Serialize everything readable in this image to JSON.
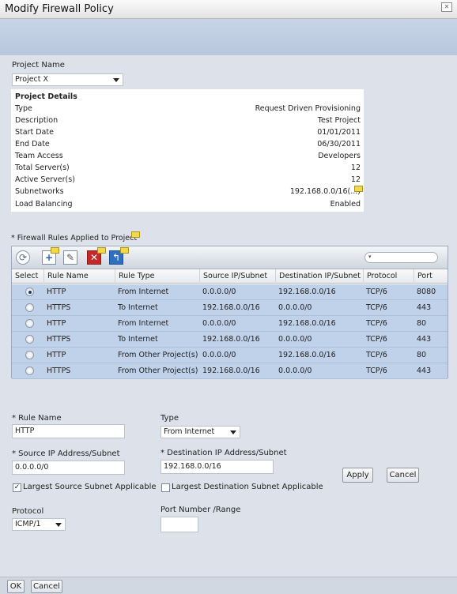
{
  "window": {
    "title": "Modify Firewall Policy"
  },
  "project": {
    "label": "Project Name",
    "selected": "Project X",
    "details_header": "Project Details",
    "details": [
      {
        "key": "Type",
        "value": "Request Driven Provisioning"
      },
      {
        "key": "Description",
        "value": "Test Project"
      },
      {
        "key": "Start Date",
        "value": "01/01/2011"
      },
      {
        "key": "End Date",
        "value": "06/30/2011"
      },
      {
        "key": "Team Access",
        "value": "Developers"
      },
      {
        "key": "Total Server(s)",
        "value": "12"
      },
      {
        "key": "Active Server(s)",
        "value": "12"
      },
      {
        "key": "Subnetworks",
        "value": "192.168.0.0/16(...)"
      },
      {
        "key": "Load Balancing",
        "value": "Enabled"
      }
    ]
  },
  "rules_grid": {
    "title": "* Firewall Rules Applied to Project",
    "columns": [
      "Select",
      "Rule Name",
      "Rule Type",
      "Source IP/Subnet",
      "Destination IP/Subnet",
      "Protocol",
      "Port"
    ],
    "rows": [
      {
        "name": "HTTP",
        "type": "From Internet",
        "source": "0.0.0.0/0",
        "dest": "192.168.0.0/16",
        "protocol": "TCP/6",
        "port": "8080",
        "selected": true
      },
      {
        "name": "HTTPS",
        "type": "To Internet",
        "source": "192.168.0.0/16",
        "dest": "0.0.0.0/0",
        "protocol": "TCP/6",
        "port": "443",
        "selected": false
      },
      {
        "name": "HTTP",
        "type": "From Internet",
        "source": "0.0.0.0/0",
        "dest": "192.168.0.0/16",
        "protocol": "TCP/6",
        "port": "80",
        "selected": false
      },
      {
        "name": "HTTPS",
        "type": "To Internet",
        "source": "192.168.0.0/16",
        "dest": "0.0.0.0/0",
        "protocol": "TCP/6",
        "port": "443",
        "selected": false
      },
      {
        "name": "HTTP",
        "type": "From Other Project(s)",
        "source": "0.0.0.0/0",
        "dest": "192.168.0.0/16",
        "protocol": "TCP/6",
        "port": "80",
        "selected": false
      },
      {
        "name": "HTTPS",
        "type": "From Other Project(s)",
        "source": "192.168.0.0/16",
        "dest": "0.0.0.0/0",
        "protocol": "TCP/6",
        "port": "443",
        "selected": false
      }
    ],
    "icons": [
      "refresh-icon",
      "add-icon",
      "edit-icon",
      "delete-icon",
      "undo-icon"
    ]
  },
  "form": {
    "rule_name_label": "* Rule Name",
    "rule_name_value": "HTTP",
    "type_label": "Type",
    "type_value": "From Internet",
    "source_label": "* Source IP Address/Subnet",
    "source_value": "0.0.0.0/0",
    "dest_label": "* Destination IP Address/Subnet",
    "dest_value": "192.168.0.0/16",
    "largest_source_label": "Largest Source Subnet Applicable",
    "largest_source_checked": true,
    "largest_dest_label": "Largest Destination Subnet Applicable",
    "largest_dest_checked": false,
    "apply_label": "Apply",
    "cancel_label": "Cancel",
    "protocol_label": "Protocol",
    "protocol_value": "ICMP/1",
    "port_label": "Port Number /Range",
    "port_value": ""
  },
  "footer": {
    "ok_label": "OK",
    "cancel_label": "Cancel"
  }
}
